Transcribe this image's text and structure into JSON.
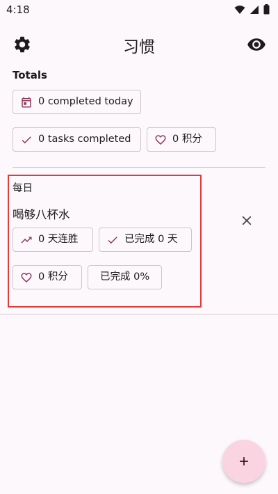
{
  "status_bar": {
    "time": "4:18"
  },
  "app_bar": {
    "title": "习惯",
    "settings_icon": "gear-icon",
    "visibility_icon": "eye-icon"
  },
  "totals": {
    "label": "Totals",
    "completed_today": "0 completed today",
    "tasks_completed": "0 tasks completed",
    "points": "0 积分"
  },
  "habit": {
    "frequency": "每日",
    "name": "喝够八杯水",
    "streak": "0 天连胜",
    "days_completed": "已完成 0 天",
    "points": "0 积分",
    "percent_completed": "已完成 0%"
  },
  "fab": {
    "icon": "plus-icon"
  },
  "colors": {
    "background": "#fdf8fc",
    "accent": "#8c3a5e",
    "chip_border": "#cfc4cc",
    "fab_background": "#fad5e1",
    "highlight": "#e03a3a"
  }
}
